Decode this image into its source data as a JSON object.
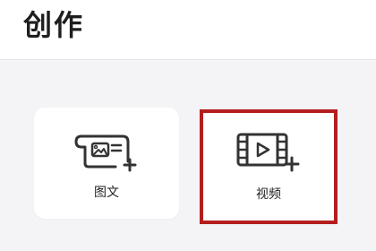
{
  "header": {
    "title": "创作"
  },
  "cards": [
    {
      "label": "图文",
      "icon": "image-text-icon"
    },
    {
      "label": "视频",
      "icon": "video-add-icon"
    }
  ],
  "colors": {
    "highlight": "#b51d1d",
    "icon_stroke": "#333333"
  }
}
